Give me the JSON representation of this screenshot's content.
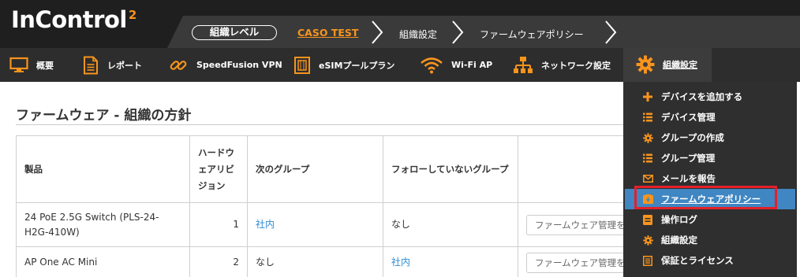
{
  "header": {
    "logo_main": "InControl",
    "logo_sup": "2",
    "breadcrumb": {
      "level_pill": "組織レベル",
      "org_link": "CASO TEST",
      "items": [
        "組織設定",
        "ファームウェアポリシー"
      ]
    }
  },
  "nav": {
    "items": [
      {
        "label": "概要",
        "icon": "monitor-icon"
      },
      {
        "label": "レポート",
        "icon": "document-icon"
      },
      {
        "label": "SpeedFusion VPN",
        "icon": "link-icon"
      },
      {
        "label": "eSIMプールプラン",
        "icon": "sim-icon"
      },
      {
        "label": "Wi-Fi AP",
        "icon": "wifi-icon"
      },
      {
        "label": "ネットワーク設定",
        "icon": "network-icon"
      },
      {
        "label": "組織設定",
        "icon": "gear-icon"
      }
    ]
  },
  "main": {
    "title": "ファームウェア - 組織の方針",
    "table": {
      "headers": [
        "製品",
        "ハードウェアリビジョン",
        "次のグループ",
        "フォローしていないグループ",
        ""
      ],
      "rows": [
        {
          "product": "24 PoE 2.5G Switch (PLS-24-H2G-410W)",
          "hw_rev": "1",
          "next_group": "社内",
          "not_following": "なし",
          "select_placeholder": "ファームウェア管理を"
        },
        {
          "product": "AP One AC Mini",
          "hw_rev": "2",
          "next_group": "なし",
          "not_following": "社内",
          "select_placeholder": "ファームウェア管理を"
        }
      ]
    }
  },
  "dropdown": {
    "items": [
      {
        "label": "デバイスを追加する",
        "icon": "plus-icon"
      },
      {
        "label": "デバイス管理",
        "icon": "list-icon"
      },
      {
        "label": "グループの作成",
        "icon": "gear-icon"
      },
      {
        "label": "グループ管理",
        "icon": "list-icon"
      },
      {
        "label": "メールを報告",
        "icon": "mail-icon"
      },
      {
        "label": "ファームウェアポリシー",
        "icon": "firmware-icon"
      },
      {
        "label": "操作ログ",
        "icon": "log-icon"
      },
      {
        "label": "組織設定",
        "icon": "gear-icon"
      },
      {
        "label": "保証とライセンス",
        "icon": "license-icon"
      }
    ],
    "selected_index": 5
  },
  "colors": {
    "accent": "#f7941d",
    "link": "#2a8dd4",
    "selected_bg": "#3f86c2",
    "highlight": "#e3202a"
  }
}
